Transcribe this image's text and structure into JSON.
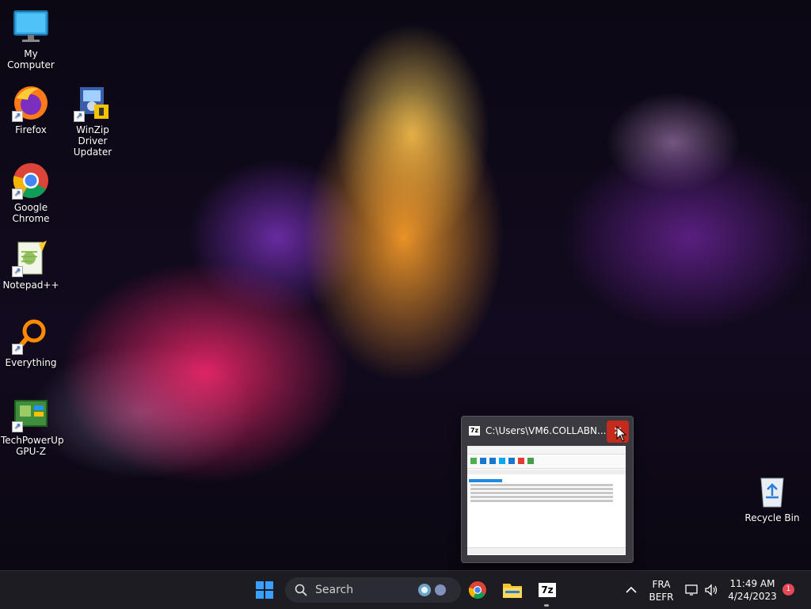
{
  "desktop": {
    "icons": [
      {
        "label": "My Computer",
        "icon": "monitor-icon"
      },
      {
        "label": "Firefox",
        "icon": "firefox-icon"
      },
      {
        "label": "WinZip Driver Updater",
        "icon": "winzip-driver-icon"
      },
      {
        "label": "Google Chrome",
        "icon": "chrome-icon"
      },
      {
        "label": "Notepad++",
        "icon": "notepadpp-icon"
      },
      {
        "label": "Everything",
        "icon": "everything-icon"
      },
      {
        "label": "TechPowerUp GPU-Z",
        "icon": "gpuz-icon"
      },
      {
        "label": "Recycle Bin",
        "icon": "recycle-bin-icon"
      }
    ]
  },
  "preview": {
    "title": "C:\\Users\\VM6.COLLABN...",
    "close_glyph": "✕"
  },
  "taskbar": {
    "search_label": "Search",
    "language_line1": "FRA",
    "language_line2": "BEFR",
    "time": "11:49 AM",
    "date": "4/24/2023",
    "notification_count": "1",
    "sevenzip_label": "7z"
  },
  "colors": {
    "close_red": "#c42b1c",
    "windows_blue": "#3aa0ff",
    "badge_red": "#e74856"
  }
}
